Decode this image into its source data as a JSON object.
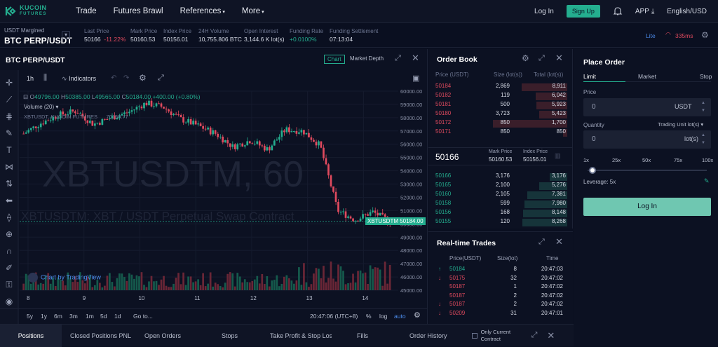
{
  "header": {
    "brand": "KUCOIN",
    "brand_sub": "FUTURES",
    "nav": [
      "Trade",
      "Futures Brawl",
      "References",
      "More"
    ],
    "login": "Log In",
    "signup": "Sign Up",
    "app": "APP",
    "lang": "English/USD"
  },
  "ticker": {
    "margin_type": "USDT Margined",
    "symbol": "BTC PERP/USDT",
    "fields": [
      {
        "label": "Last Price",
        "value": "50166",
        "change": "-11.22%"
      },
      {
        "label": "Mark Price",
        "value": "50160.53"
      },
      {
        "label": "Index Price",
        "value": "50156.01"
      },
      {
        "label": "24H Volume",
        "value": "10,755.806 BTC"
      },
      {
        "label": "Open Interest",
        "value": "3,144.6 K lot(s)"
      },
      {
        "label": "Funding Rate",
        "value": "+0.0100%"
      },
      {
        "label": "Funding Settlement",
        "value": "07:13:04"
      }
    ],
    "lite": "Lite",
    "latency": "335ms"
  },
  "chart": {
    "title": "BTC PERP/USDT",
    "tab_chart": "Chart",
    "tab_depth": "Market Depth",
    "interval": "1h",
    "indicators": "Indicators",
    "ohlc": {
      "o": "49796.00",
      "h": "50385.00",
      "l": "49565.00",
      "c": "50184.00",
      "chg": "+400.00 (+0.80%)"
    },
    "volume_label": "Volume (20)",
    "sub_label": "XBTUSDT, KUCOIN FUTURES",
    "sub_value": "70158.77",
    "watermark1": "XBTUSDTM, 60",
    "watermark2": "XBTUSDTM: XBT / USDT Perpetual Swap Contract",
    "price_tag": "50184.00",
    "price_tag_label": "XBTUSDTM",
    "tv_label": "Chart by TradingView",
    "y_ticks": [
      "60000.00",
      "59000.00",
      "58000.00",
      "57000.00",
      "56000.00",
      "55000.00",
      "54000.00",
      "53000.00",
      "52000.00",
      "51000.00",
      "50000.00",
      "49000.00",
      "48000.00",
      "47000.00",
      "46000.00",
      "45000.00"
    ],
    "x_ticks": [
      "8",
      "9",
      "10",
      "11",
      "12",
      "13",
      "14"
    ],
    "ranges": [
      "5y",
      "1y",
      "6m",
      "3m",
      "1m",
      "5d",
      "1d",
      "Go to..."
    ],
    "time": "20:47:06 (UTC+8)",
    "pct": "%",
    "log": "log",
    "auto": "auto"
  },
  "chart_data": {
    "type": "line",
    "ylim": [
      45000,
      60000
    ],
    "x": [
      "8",
      "9",
      "10",
      "11",
      "12",
      "13",
      "14"
    ],
    "series": [
      {
        "values": [
          56800,
          57600,
          58200,
          58500,
          57500,
          58000,
          58400,
          59100,
          58800,
          57900,
          57400,
          56800,
          55800,
          56300,
          55600,
          57100,
          57000,
          55900,
          51000,
          50300,
          50900,
          50184
        ]
      }
    ]
  },
  "orderbook": {
    "title": "Order Book",
    "h_price": "Price (USDT)",
    "h_size": "Size (lot(s))",
    "h_total": "Total (lot(s))",
    "asks": [
      [
        "50184",
        "2,869",
        "8,911",
        0.55
      ],
      [
        "50182",
        "119",
        "6,042",
        0.38
      ],
      [
        "50181",
        "500",
        "5,923",
        0.37
      ],
      [
        "50180",
        "3,723",
        "5,423",
        0.34
      ],
      [
        "50172",
        "850",
        "1,700",
        0.9
      ],
      [
        "50171",
        "850",
        "850",
        0.05
      ]
    ],
    "last": "50166",
    "mark_label": "Mark Price",
    "mark": "50160.53",
    "index_label": "Index Price",
    "index": "50156.01",
    "bids": [
      [
        "50166",
        "3,176",
        "3,176",
        0.21
      ],
      [
        "50165",
        "2,100",
        "5,276",
        0.34
      ],
      [
        "50160",
        "2,105",
        "7,381",
        0.48
      ],
      [
        "50158",
        "599",
        "7,980",
        0.52
      ],
      [
        "50156",
        "168",
        "8,148",
        0.53
      ],
      [
        "50155",
        "120",
        "8,268",
        0.54
      ]
    ]
  },
  "trades": {
    "title": "Real-time Trades",
    "h_price": "Price(USDT)",
    "h_size": "Size(lot)",
    "h_time": "Time",
    "rows": [
      [
        "↑",
        "50184",
        "8",
        "20:47:03",
        "g"
      ],
      [
        "↓",
        "50175",
        "32",
        "20:47:02",
        "r"
      ],
      [
        "",
        "50187",
        "1",
        "20:47:02",
        "r"
      ],
      [
        "",
        "50187",
        "2",
        "20:47:02",
        "r"
      ],
      [
        "↓",
        "50187",
        "2",
        "20:47:02",
        "r"
      ],
      [
        "↓",
        "50209",
        "31",
        "20:47:01",
        "r"
      ]
    ]
  },
  "place": {
    "title": "Place Order",
    "tabs": [
      "Limit",
      "Market",
      "Stop"
    ],
    "price_label": "Price",
    "price_value": "0",
    "price_unit": "USDT",
    "qty_label": "Quantity",
    "unit_select": "Trading Unit lot(s)",
    "qty_value": "0",
    "qty_unit": "lot(s)",
    "lev_ticks": [
      "1x",
      "25x",
      "50x",
      "75x",
      "100x"
    ],
    "leverage": "Leverage: 5x",
    "login": "Log In"
  },
  "bottom": {
    "tabs": [
      "Positions",
      "Closed Positions PNL",
      "Open Orders",
      "Stops",
      "Take Profit & Stop Loss",
      "Fills",
      "Order History"
    ],
    "only_current": "Only Current Contract"
  },
  "colors": {
    "up": "#24ae8f",
    "down": "#e04a5e",
    "bg": "#0a0f20"
  }
}
